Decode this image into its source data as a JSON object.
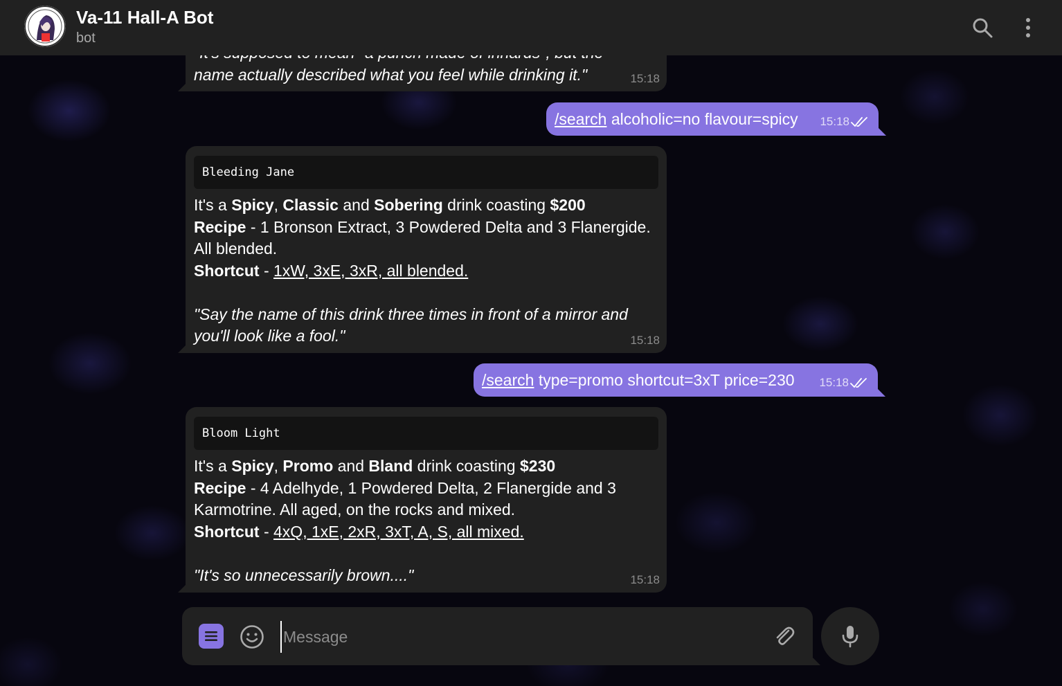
{
  "header": {
    "title": "Va-11 Hall-A Bot",
    "subtitle": "bot"
  },
  "messages": [
    {
      "quote_line1": "\"It's supposed to mean \"a punch made of innards\", but the",
      "quote_line2": "name actually described what you feel while drinking it.\"",
      "time": "15:18"
    },
    {
      "command": "/search",
      "args": " alcoholic=no flavour=spicy",
      "time": "15:18"
    },
    {
      "code": "Bleeding Jane",
      "intro": "It's a ",
      "tag1": "Spicy",
      "sep1": ", ",
      "tag2": "Classic",
      "sep2": " and ",
      "tag3": "Sobering",
      "mid": " drink coasting ",
      "price": "$200",
      "recipe_label": "Recipe",
      "recipe_text": " - 1 Bronson Extract, 3 Powdered Delta and 3 Flanergide.",
      "recipe_text2": "All blended.",
      "shortcut_label": "Shortcut",
      "shortcut_sep": " - ",
      "shortcut_text": "1xW, 3xE, 3xR, all blended.",
      "quote_line1": "\"Say the name of this drink three times in front of a mirror and",
      "quote_line2": "you'll look like a fool.\"",
      "time": "15:18"
    },
    {
      "command": "/search",
      "args": " type=promo shortcut=3xT price=230",
      "time": "15:18"
    },
    {
      "code": "Bloom Light",
      "intro": "It's a ",
      "tag1": "Spicy",
      "sep1": ", ",
      "tag2": "Promo",
      "sep2": " and ",
      "tag3": "Bland",
      "mid": " drink coasting ",
      "price": "$230",
      "recipe_label": "Recipe",
      "recipe_text": " - 4 Adelhyde, 1 Powdered Delta, 2 Flanergide and 3",
      "recipe_text2": "Karmotrine. All aged, on the rocks and mixed.",
      "shortcut_label": "Shortcut",
      "shortcut_sep": " - ",
      "shortcut_text": "4xQ, 1xE, 2xR, 3xT, A, S, all mixed.",
      "quote_line1": "\"It's so unnecessarily brown....\"",
      "time": "15:18"
    }
  ],
  "composer": {
    "placeholder": "Message"
  },
  "icons": {
    "search": "search-icon",
    "menu": "more-vertical-icon",
    "bot_menu": "bot-menu-icon",
    "emoji": "emoji-icon",
    "attach": "paperclip-icon",
    "mic": "microphone-icon",
    "read": "double-check-icon"
  },
  "colors": {
    "accent": "#8774e1",
    "bubble_in": "#212121",
    "header": "#212121"
  }
}
